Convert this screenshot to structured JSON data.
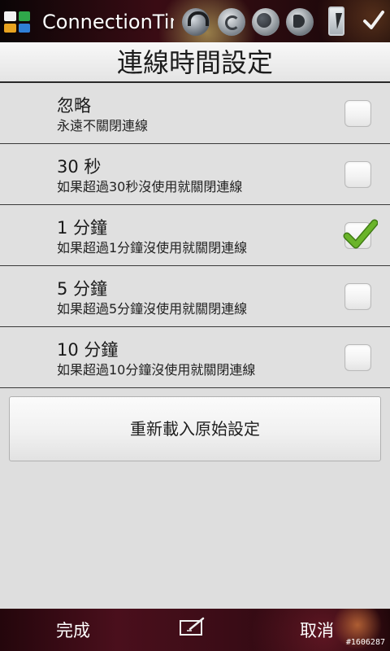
{
  "status_bar": {
    "app_title": "ConnectionTime",
    "icons": [
      "app-grid-icon",
      "headset-icon",
      "sync-icon",
      "globe-icon",
      "speaker-icon",
      "battery-icon",
      "check-icon"
    ]
  },
  "header": {
    "title": "連線時間設定"
  },
  "options": [
    {
      "title": "忽略",
      "description": "永遠不關閉連線",
      "checked": false
    },
    {
      "title": "30 秒",
      "description": "如果超過30秒沒使用就關閉連線",
      "checked": false
    },
    {
      "title": "1 分鐘",
      "description": "如果超過1分鐘沒使用就關閉連線",
      "checked": true
    },
    {
      "title": "5 分鐘",
      "description": "如果超過5分鐘沒使用就關閉連線",
      "checked": false
    },
    {
      "title": "10 分鐘",
      "description": "如果超過10分鐘沒使用就關閉連線",
      "checked": false
    }
  ],
  "reset_button": {
    "label": "重新載入原始設定"
  },
  "bottom_bar": {
    "done_label": "完成",
    "cancel_label": "取消",
    "center_icon": "edit-icon",
    "watermark": "#1606287"
  },
  "colors": {
    "check_green": "#6ab42a",
    "list_background": "#e0e0e0",
    "bar_background": "#3a0c16"
  }
}
